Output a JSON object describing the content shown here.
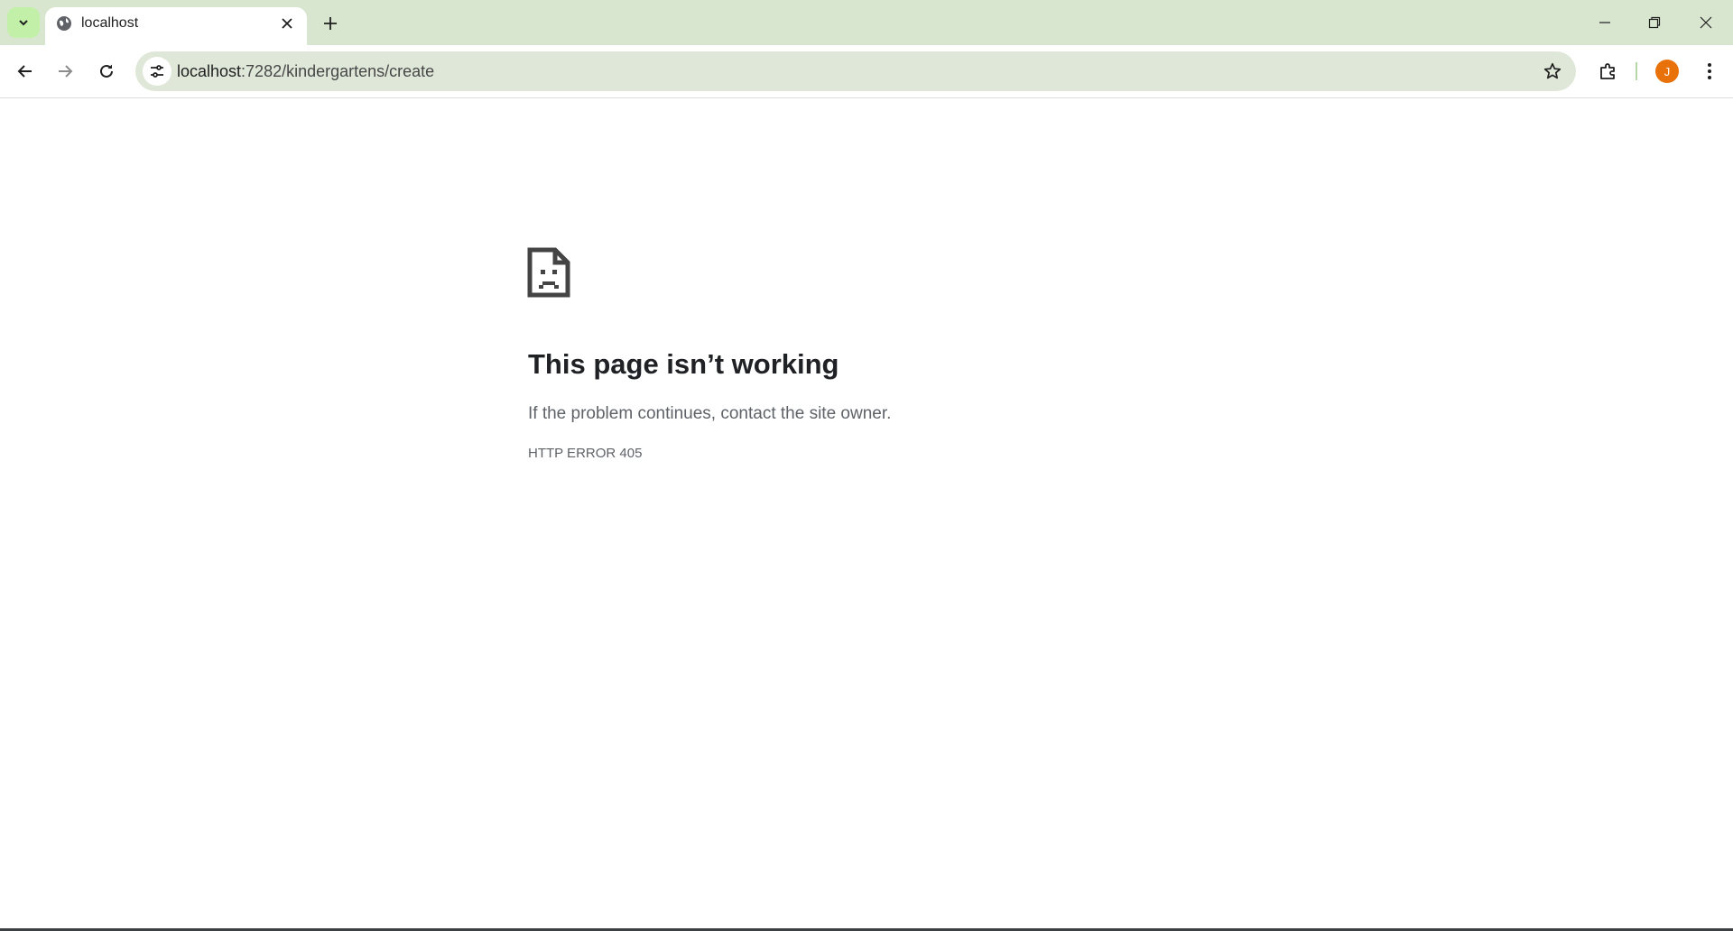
{
  "tabstrip": {
    "tab_title": "localhost",
    "tab_icon": "globe-icon"
  },
  "toolbar": {
    "url_host": "localhost",
    "url_rest": ":7282/kindergartens/create",
    "profile_initial": "J",
    "profile_color": "#e8710a"
  },
  "error": {
    "icon": "sad-page-icon",
    "title": "This page isn’t working",
    "description": "If the problem continues, contact the site owner.",
    "code": "HTTP ERROR 405"
  },
  "colors": {
    "tabstrip_bg": "#d8e6cf",
    "omnibox_bg": "#dfe8d8"
  }
}
